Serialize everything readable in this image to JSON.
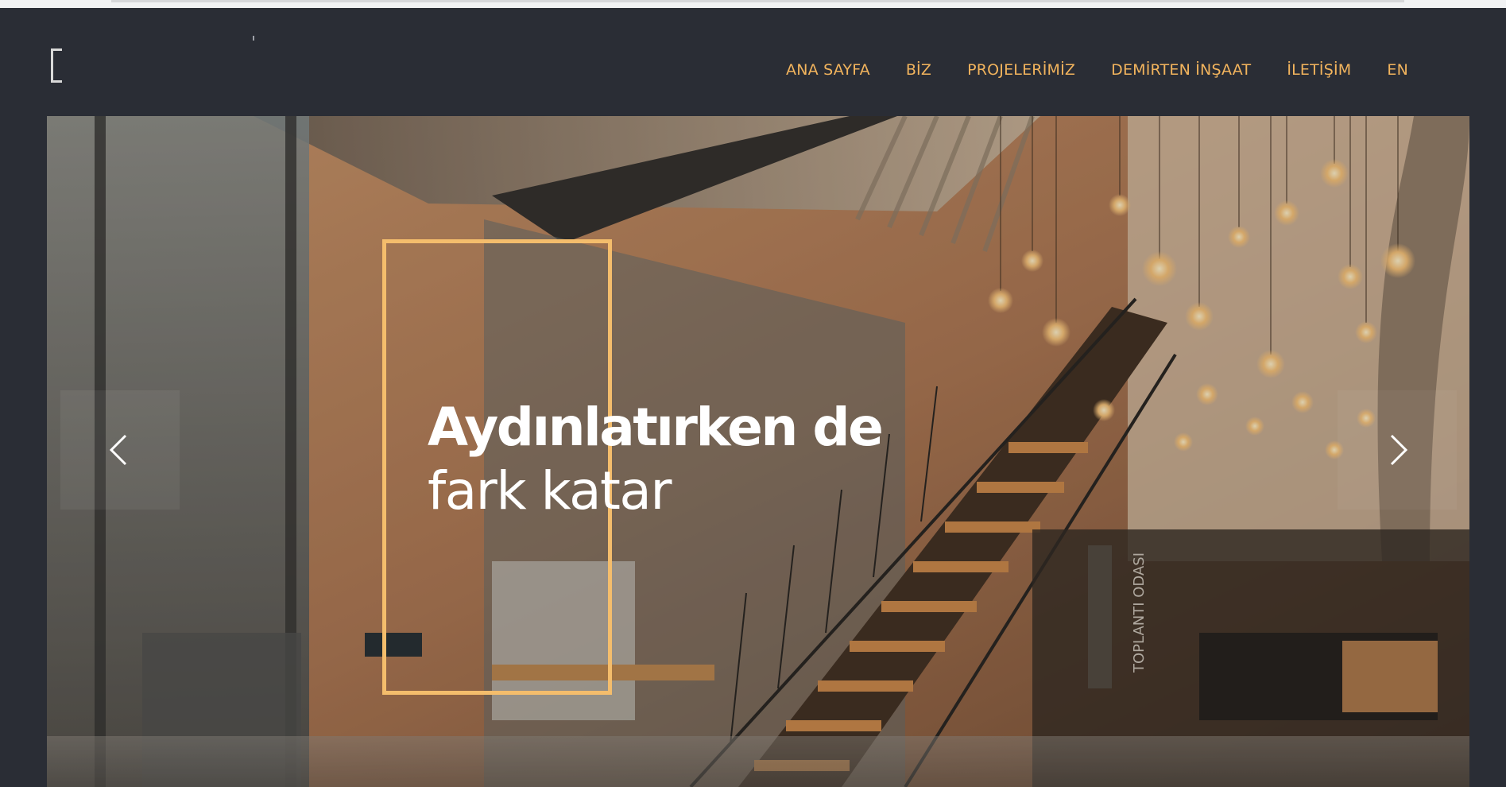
{
  "nav": {
    "items": [
      {
        "label": "ANA SAYFA"
      },
      {
        "label": "BİZ"
      },
      {
        "label": "PROJELERİMİZ"
      },
      {
        "label": "DEMİRTEN İNŞAAT"
      },
      {
        "label": "İLETİŞİM"
      },
      {
        "label": "EN"
      }
    ]
  },
  "hero": {
    "headline_bold": "Aydınlatırken de",
    "headline_light": "fark katar",
    "image_sign_text": "TOPLANTI ODASI"
  },
  "slider": {
    "prev_icon": "chevron-left-icon",
    "next_icon": "chevron-right-icon"
  },
  "colors": {
    "accent": "#f4bd6c",
    "nav_text": "#f2b45d",
    "header_bg": "#2a2d35",
    "headline": "#ffffff"
  }
}
